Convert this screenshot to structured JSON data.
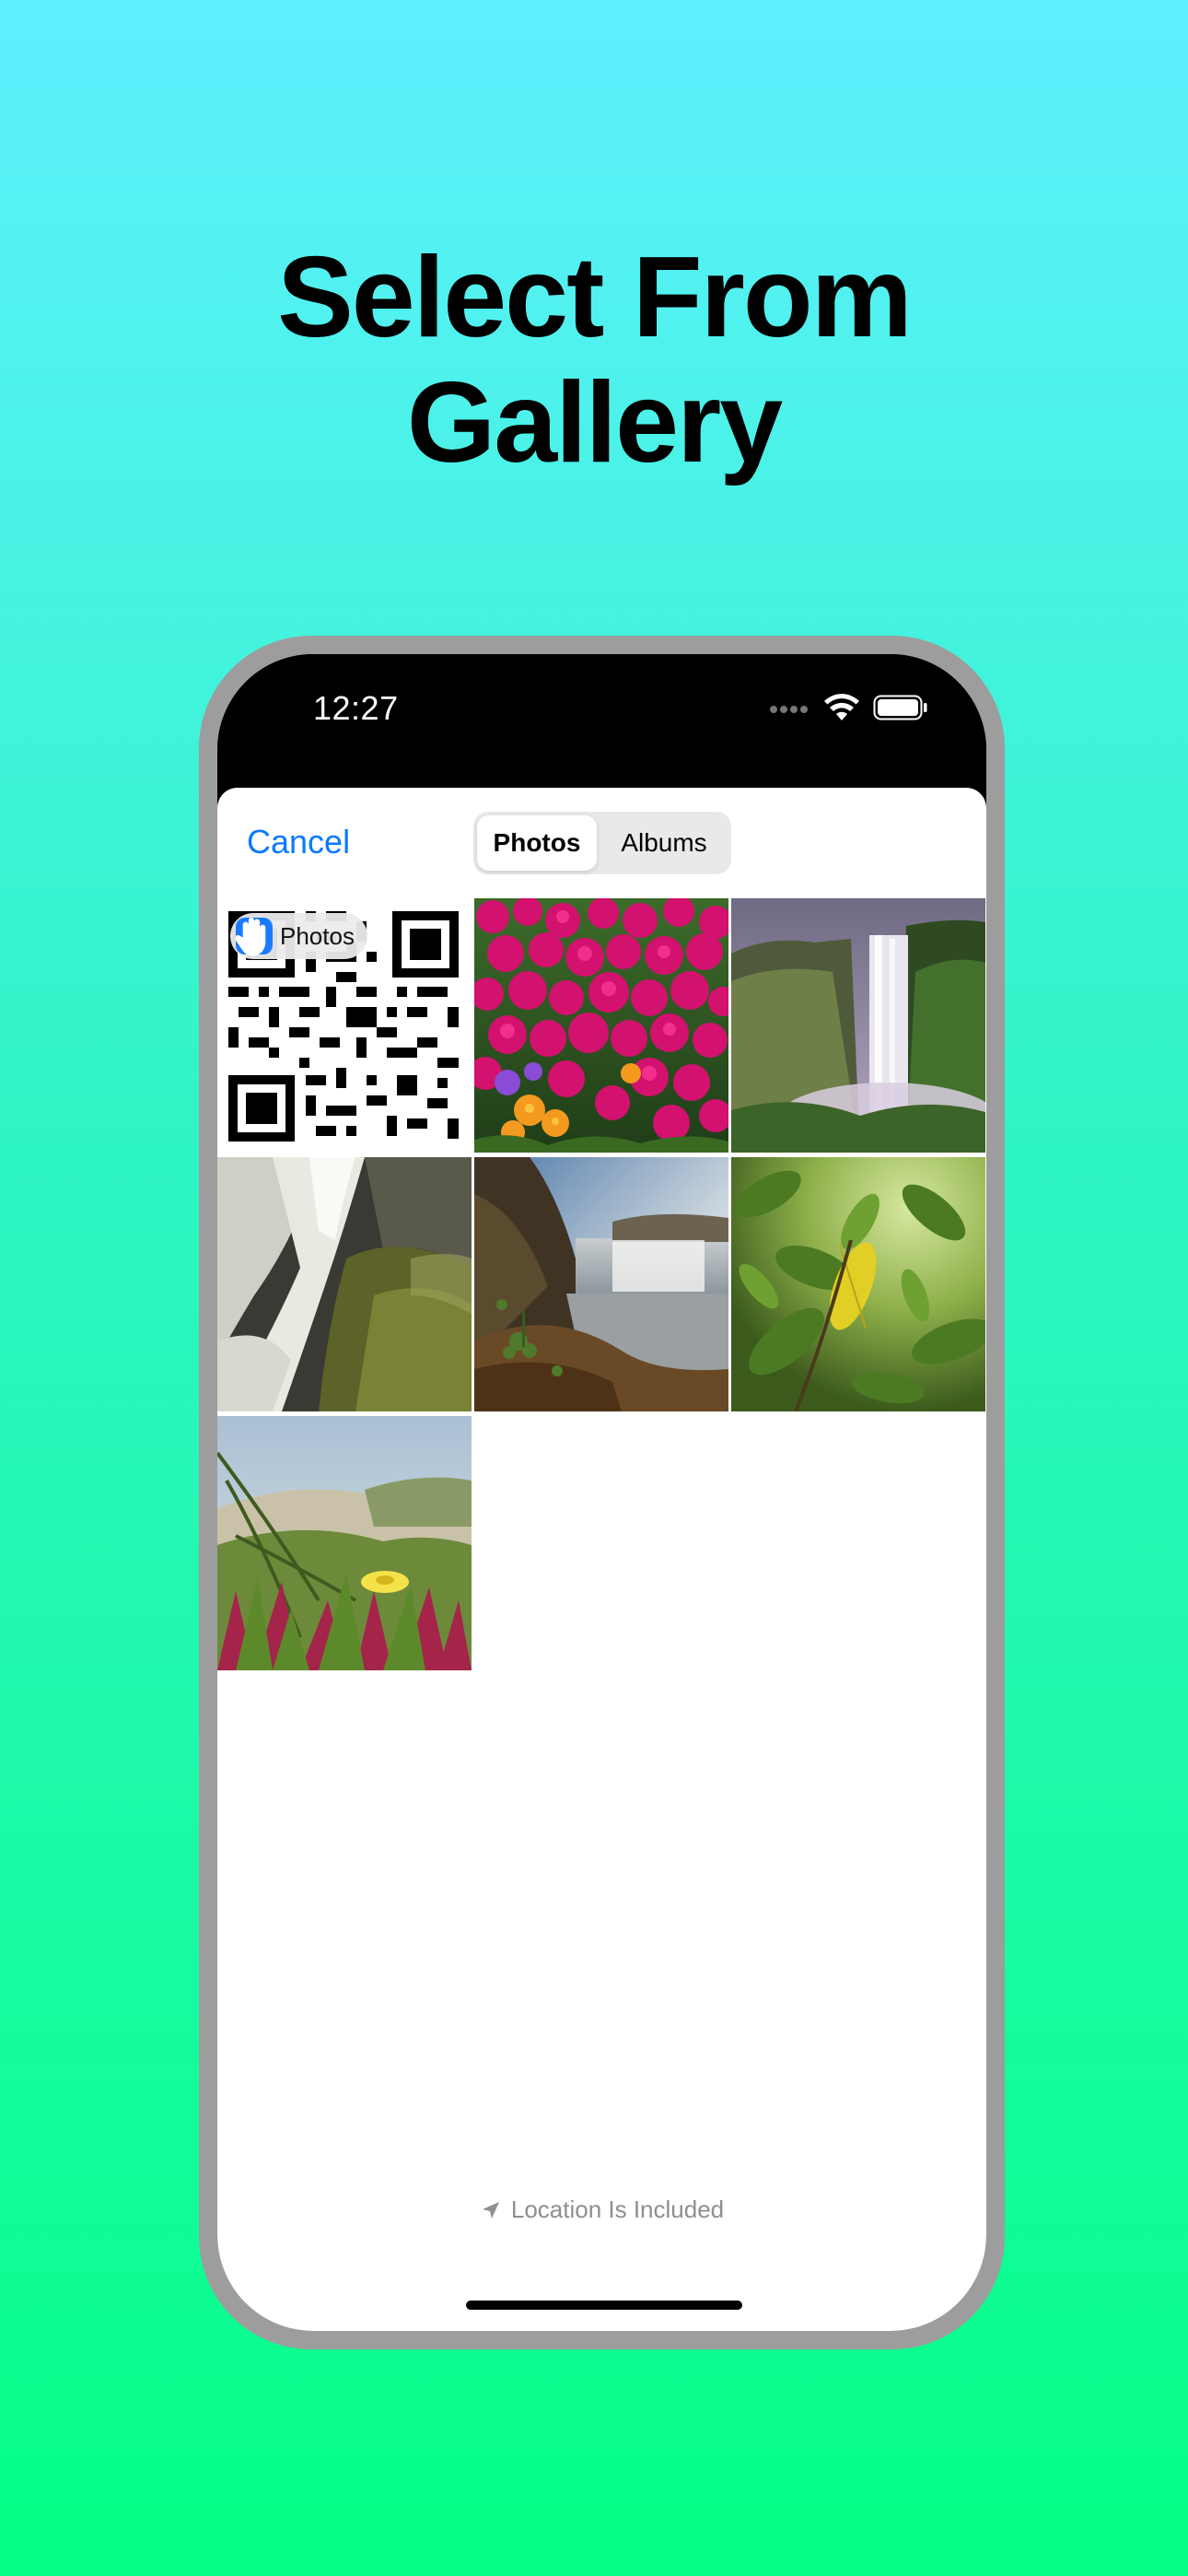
{
  "headline": {
    "line1": "Select From",
    "line2": "Gallery"
  },
  "status_bar": {
    "time": "12:27",
    "icons": [
      "cellular-dots-icon",
      "wifi-icon",
      "battery-icon"
    ]
  },
  "picker": {
    "cancel_label": "Cancel",
    "tabs": [
      {
        "label": "Photos",
        "selected": true
      },
      {
        "label": "Albums",
        "selected": false
      }
    ],
    "photos_tag_label": "Photos",
    "photos": [
      {
        "subject": "QR code"
      },
      {
        "subject": "Magenta flowers"
      },
      {
        "subject": "Waterfall cliff"
      },
      {
        "subject": "Long-exposure waterfall"
      },
      {
        "subject": "Waterfall at sunrise"
      },
      {
        "subject": "Green leaves"
      },
      {
        "subject": "Yellow flower in grass"
      }
    ],
    "location_note": "Location Is Included"
  },
  "colors": {
    "accent": "#0a7aff",
    "background_top": "#5ef0ff",
    "background_bottom": "#05ff86"
  }
}
